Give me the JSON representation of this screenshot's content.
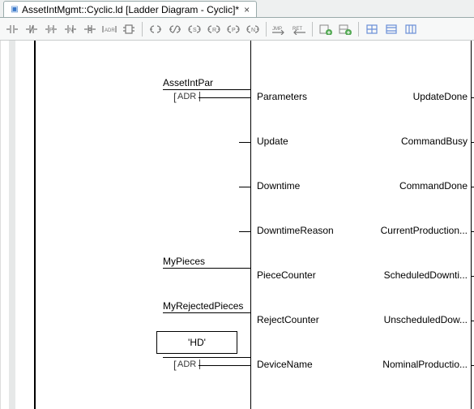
{
  "tab": {
    "title": "AssetIntMgmt::Cyclic.ld [Ladder Diagram - Cyclic]*",
    "close": "×"
  },
  "toolbar": {
    "btn_contact_no": "-| |-",
    "btn_contact_nc": "-|/|-",
    "btn_posedge": "-|P|-",
    "btn_negedge": "-|N|-",
    "btn_not": "-|◦|-",
    "btn_adr": "[ADR]",
    "btn_fb": "FB",
    "btn_coil": "( )",
    "btn_ncoil": "(/)",
    "btn_scoil": "(S)",
    "btn_rcoil": "(R)",
    "btn_pcoil": "(P)",
    "btn_ncoil2": "(N)",
    "btn_jmp": "JMP→",
    "btn_ret": "RET←",
    "btn_add_seg": "add",
    "btn_add_green": "add2",
    "btn_grid1": "g1",
    "btn_grid2": "g2",
    "btn_grid3": "g3"
  },
  "inputs": {
    "0": {
      "var": "AssetIntPar",
      "port": "Parameters",
      "adr": true
    },
    "1": {
      "var": "",
      "port": "Update",
      "adr": false
    },
    "2": {
      "var": "",
      "port": "Downtime",
      "adr": false
    },
    "3": {
      "var": "",
      "port": "DowntimeReason",
      "adr": false
    },
    "4": {
      "var": "MyPieces",
      "port": "PieceCounter",
      "adr": false
    },
    "5": {
      "var": "MyRejectedPieces",
      "port": "RejectCounter",
      "adr": false
    },
    "6": {
      "var": "'HD'",
      "port": "DeviceName",
      "adr": true,
      "box": true
    }
  },
  "outputs": {
    "0": "UpdateDone",
    "1": "CommandBusy",
    "2": "CommandDone",
    "3": "CurrentProduction...",
    "4": "ScheduledDownti...",
    "5": "UnscheduledDow...",
    "6": "NominalProductio..."
  },
  "adr_label": "ADR"
}
